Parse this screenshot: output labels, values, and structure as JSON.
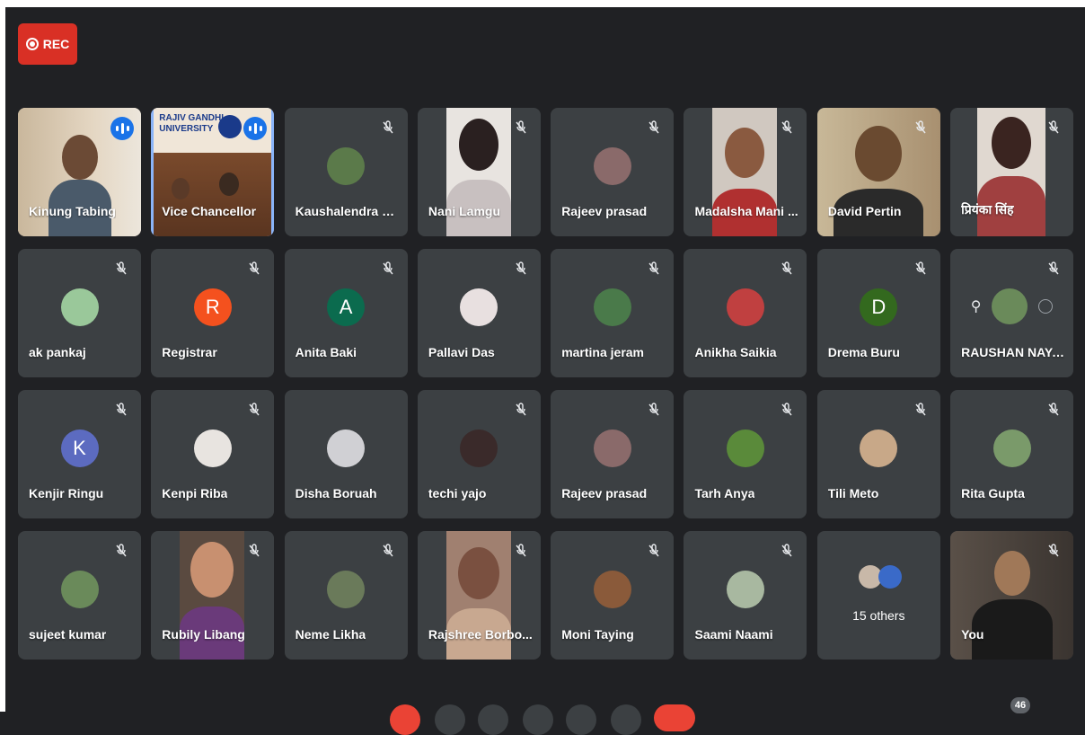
{
  "recording": {
    "label": "REC"
  },
  "participants": [
    {
      "name": "Kinung Tabing"
    },
    {
      "name": "Vice Chancellor"
    },
    {
      "name": "Kaushalendra Pr..."
    },
    {
      "name": "Nani Lamgu"
    },
    {
      "name": "Rajeev prasad"
    },
    {
      "name": "Madalsha Mani ..."
    },
    {
      "name": "David Pertin"
    },
    {
      "name": "प्रियंका सिंह"
    },
    {
      "name": "ak pankaj"
    },
    {
      "name": "Registrar",
      "initial": "R"
    },
    {
      "name": "Anita Baki",
      "initial": "A"
    },
    {
      "name": "Pallavi Das"
    },
    {
      "name": "martina jeram"
    },
    {
      "name": "Anikha Saikia"
    },
    {
      "name": "Drema Buru",
      "initial": "D"
    },
    {
      "name": "RAUSHAN NAYAK"
    },
    {
      "name": "Kenjir Ringu",
      "initial": "K"
    },
    {
      "name": "Kenpi Riba"
    },
    {
      "name": "Disha Boruah"
    },
    {
      "name": "techi yajo"
    },
    {
      "name": "Rajeev prasad"
    },
    {
      "name": "Tarh Anya"
    },
    {
      "name": "Tili Meto"
    },
    {
      "name": "Rita Gupta"
    },
    {
      "name": "sujeet kumar"
    },
    {
      "name": "Rubily Libang"
    },
    {
      "name": "Neme Likha"
    },
    {
      "name": "Rajshree Borbo..."
    },
    {
      "name": "Moni Taying"
    },
    {
      "name": "Saami Naami"
    },
    {
      "name": "You"
    }
  ],
  "others": {
    "label": "15 others"
  },
  "participant_count": "46",
  "logo_text": {
    "line1": "RAJIV GANDHI",
    "line2": "UNIVERSITY"
  },
  "colors": {
    "background": "#202124",
    "tile": "#3c4043",
    "rec": "#d93025",
    "speaking": "#8ab4f8",
    "talk": "#1a73e8"
  }
}
